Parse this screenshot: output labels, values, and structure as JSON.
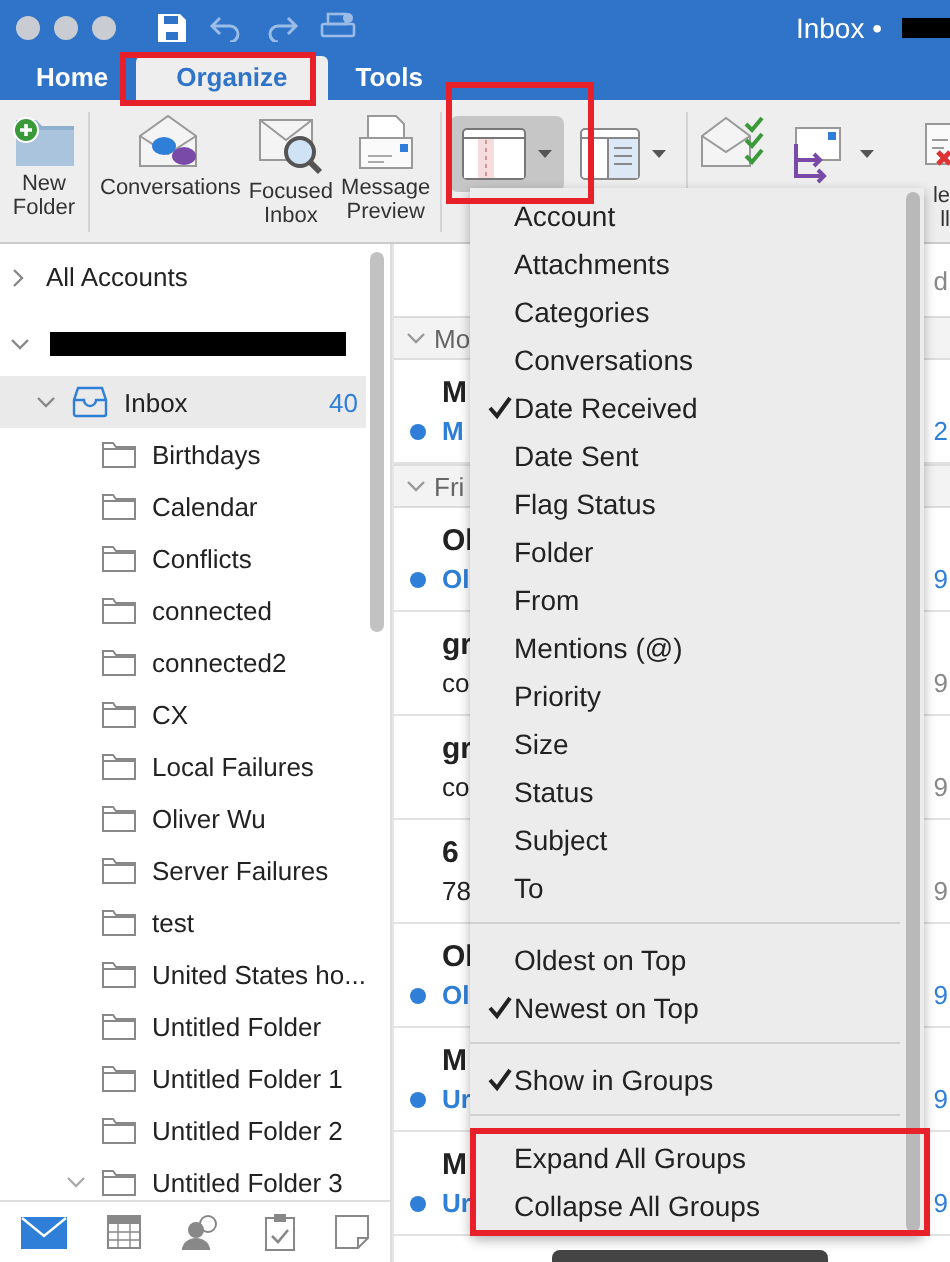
{
  "window": {
    "title": "Inbox •"
  },
  "tabs": [
    {
      "label": "Home",
      "selected": false
    },
    {
      "label": "Organize",
      "selected": true
    },
    {
      "label": "Tools",
      "selected": false
    }
  ],
  "ribbon": [
    {
      "kind": "labeled",
      "lines": [
        "New",
        "Folder"
      ]
    },
    {
      "kind": "labeled",
      "lines": [
        "Conversations"
      ]
    },
    {
      "kind": "labeled",
      "lines": [
        "Focused",
        "Inbox"
      ]
    },
    {
      "kind": "labeled",
      "lines": [
        "Message",
        "Preview"
      ]
    },
    {
      "kind": "dropdown",
      "selected": true
    },
    {
      "kind": "dropdown",
      "selected": false
    },
    {
      "kind": "plain"
    },
    {
      "kind": "dropdown",
      "selected": false
    },
    {
      "kind": "labeled",
      "lines": [
        "le",
        "ll"
      ]
    }
  ],
  "sidebar": {
    "all_accounts": "All Accounts",
    "account_expanded": true,
    "inbox": {
      "label": "Inbox",
      "count": "40",
      "selected": true,
      "expanded": true
    },
    "folders": [
      {
        "label": "Birthdays"
      },
      {
        "label": "Calendar"
      },
      {
        "label": "Conflicts"
      },
      {
        "label": "connected"
      },
      {
        "label": "connected2"
      },
      {
        "label": "CX"
      },
      {
        "label": "Local Failures"
      },
      {
        "label": "Oliver Wu"
      },
      {
        "label": "Server Failures"
      },
      {
        "label": "test"
      },
      {
        "label": "United States ho..."
      },
      {
        "label": "Untitled Folder"
      },
      {
        "label": "Untitled Folder 1"
      },
      {
        "label": "Untitled Folder 2"
      },
      {
        "label": "Untitled Folder 3",
        "expandable": true
      }
    ],
    "nav": [
      {
        "selected": true
      },
      {
        "selected": false
      },
      {
        "selected": false
      },
      {
        "selected": false
      },
      {
        "selected": false
      }
    ]
  },
  "message_list": {
    "top_right": "d",
    "items": [
      {
        "kind": "group",
        "label": "Mo"
      },
      {
        "kind": "message",
        "sender": "M",
        "preview": "M",
        "unread": true,
        "date": "2"
      },
      {
        "kind": "group",
        "label": "Fri"
      },
      {
        "kind": "message",
        "sender": "Ol",
        "preview": "Ol",
        "unread": true,
        "date": "9"
      },
      {
        "kind": "message",
        "sender": "gr",
        "preview": "co",
        "unread": false,
        "date": "9"
      },
      {
        "kind": "message",
        "sender": "gr",
        "preview": "co",
        "unread": false,
        "date": "9"
      },
      {
        "kind": "message",
        "sender": "6",
        "preview": "78",
        "unread": false,
        "date": "9"
      },
      {
        "kind": "message",
        "sender": "Ol",
        "preview": "Ol",
        "unread": true,
        "date": "9"
      },
      {
        "kind": "message",
        "sender": "M",
        "preview": "Ur",
        "unread": true,
        "date": "9"
      },
      {
        "kind": "message",
        "sender": "M",
        "preview": "Ur",
        "unread": true,
        "date": "9"
      }
    ]
  },
  "arrange_menu": [
    [
      {
        "label": "Account",
        "checked": false
      },
      {
        "label": "Attachments",
        "checked": false
      },
      {
        "label": "Categories",
        "checked": false
      },
      {
        "label": "Conversations",
        "checked": false
      },
      {
        "label": "Date Received",
        "checked": true
      },
      {
        "label": "Date Sent",
        "checked": false
      },
      {
        "label": "Flag Status",
        "checked": false
      },
      {
        "label": "Folder",
        "checked": false
      },
      {
        "label": "From",
        "checked": false
      },
      {
        "label": "Mentions (@)",
        "checked": false
      },
      {
        "label": "Priority",
        "checked": false
      },
      {
        "label": "Size",
        "checked": false
      },
      {
        "label": "Status",
        "checked": false
      },
      {
        "label": "Subject",
        "checked": false
      },
      {
        "label": "To",
        "checked": false
      }
    ],
    [
      {
        "label": "Oldest on Top",
        "checked": false
      },
      {
        "label": "Newest on Top",
        "checked": true
      }
    ],
    [
      {
        "label": "Show in Groups",
        "checked": true
      }
    ],
    [
      {
        "label": "Expand All Groups",
        "checked": false
      },
      {
        "label": "Collapse All Groups",
        "checked": false
      }
    ]
  ]
}
